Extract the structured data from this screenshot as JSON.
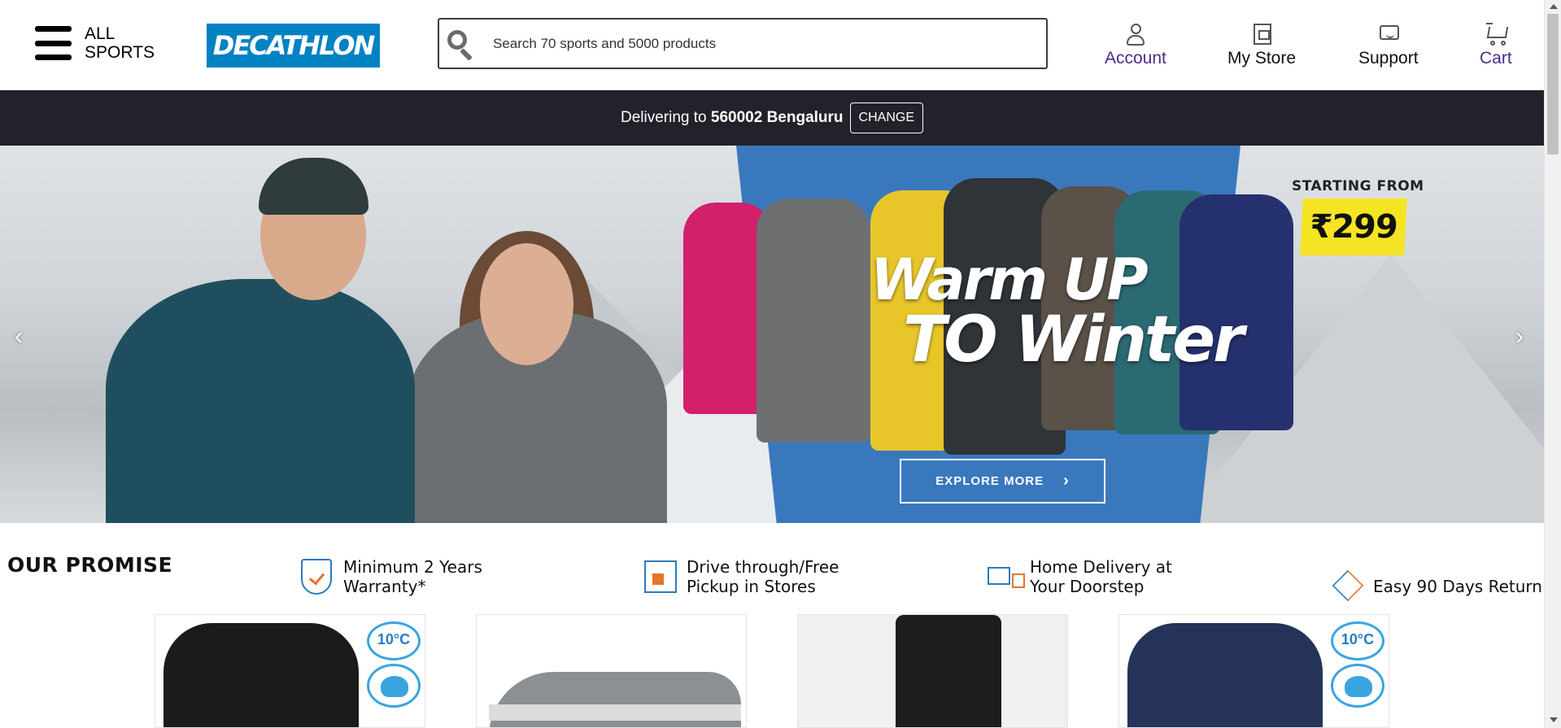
{
  "header": {
    "menu_line1": "ALL",
    "menu_line2": "SPORTS",
    "logo_text": "DECATHLON",
    "search_placeholder": "Search 70 sports and 5000 products",
    "nav": {
      "account": "Account",
      "store": "My Store",
      "support": "Support",
      "cart": "Cart"
    }
  },
  "delivery": {
    "prefix": "Delivering to",
    "location": "560002 Bengaluru",
    "change_label": "CHANGE"
  },
  "hero": {
    "title_line1": "Warm UP",
    "title_line2": "TO Winter",
    "starting_from": "STARTING FROM",
    "price": "₹299",
    "cta_label": "EXPLORE MORE",
    "cta_chevron": "›",
    "prev_arrow": "‹",
    "next_arrow": "›"
  },
  "promise": {
    "title": "OUR PROMISE",
    "items": [
      {
        "line1": "Minimum 2 Years",
        "line2": "Warranty*",
        "icon": "warranty-shield-icon"
      },
      {
        "line1": "Drive through/Free",
        "line2": "Pickup in Stores",
        "icon": "store-pickup-icon"
      },
      {
        "line1": "Home Delivery at",
        "line2": "Your Doorstep",
        "icon": "delivery-truck-icon"
      },
      {
        "line1": "Easy 90 Days Return",
        "line2": "",
        "icon": "return-arrows-icon"
      }
    ]
  },
  "products": {
    "badge_temp": "10°C"
  },
  "colors": {
    "brand": "#0082c3",
    "dark_bar": "#22222b",
    "accent_purple": "#4b2a8a",
    "price_yellow": "#f5e423"
  }
}
